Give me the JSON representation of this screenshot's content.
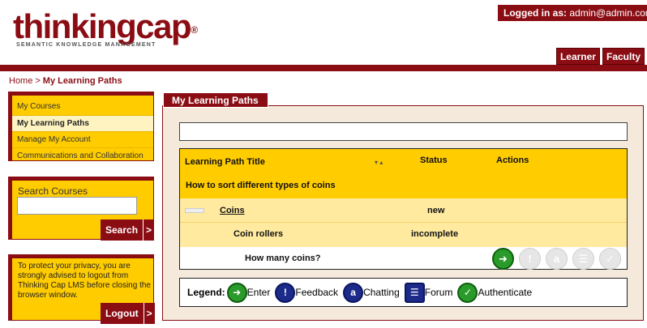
{
  "header": {
    "logo_text": "thinkingcap",
    "logo_reg": "®",
    "logo_tagline": "SEMANTIC KNOWLEDGE MANAGEMENT",
    "logged_in_label": "Logged in as:",
    "logged_in_user": "admin@admin.com",
    "role_tabs": [
      "Learner",
      "Faculty"
    ]
  },
  "breadcrumb": {
    "home": "Home",
    "separator": ">",
    "current": "My Learning Paths"
  },
  "sidebar": {
    "items": [
      {
        "label": "My Courses",
        "active": false
      },
      {
        "label": "My Learning Paths",
        "active": true
      },
      {
        "label": "Manage My Account",
        "active": false
      },
      {
        "label": "Communications and Collaboration",
        "active": false
      }
    ],
    "search": {
      "label": "Search Courses",
      "value": "",
      "button": "Search",
      "arrow": ">"
    },
    "privacy": {
      "message": "To protect your privacy, you are strongly advised to logout from Thinking Cap LMS before closing the browser window.",
      "button": "Logout",
      "arrow": ">"
    }
  },
  "main": {
    "title": "My Learning Paths",
    "table": {
      "headers": {
        "title": "Learning Path Title",
        "status": "Status",
        "actions": "Actions"
      },
      "path": "How to sort different types of coins",
      "course": {
        "title": "Coins",
        "status": "new"
      },
      "unit": {
        "title": "Coin rollers",
        "status": "incomplete"
      },
      "item": {
        "title": "How many coins?"
      },
      "action_icons": [
        "enter-icon",
        "feedback-icon",
        "chatting-icon",
        "forum-icon",
        "authenticate-icon"
      ]
    },
    "legend": {
      "label": "Legend:",
      "items": [
        {
          "icon": "enter-icon",
          "label": "Enter"
        },
        {
          "icon": "feedback-icon",
          "label": "Feedback"
        },
        {
          "icon": "chatting-icon",
          "label": "Chatting"
        },
        {
          "icon": "forum-icon",
          "label": "Forum"
        },
        {
          "icon": "authenticate-icon",
          "label": "Authenticate"
        }
      ]
    }
  },
  "colors": {
    "brand": "#8b0d14",
    "accent": "#ffcc00",
    "enter": "#2a9a2a",
    "info": "#1c2b8a"
  }
}
